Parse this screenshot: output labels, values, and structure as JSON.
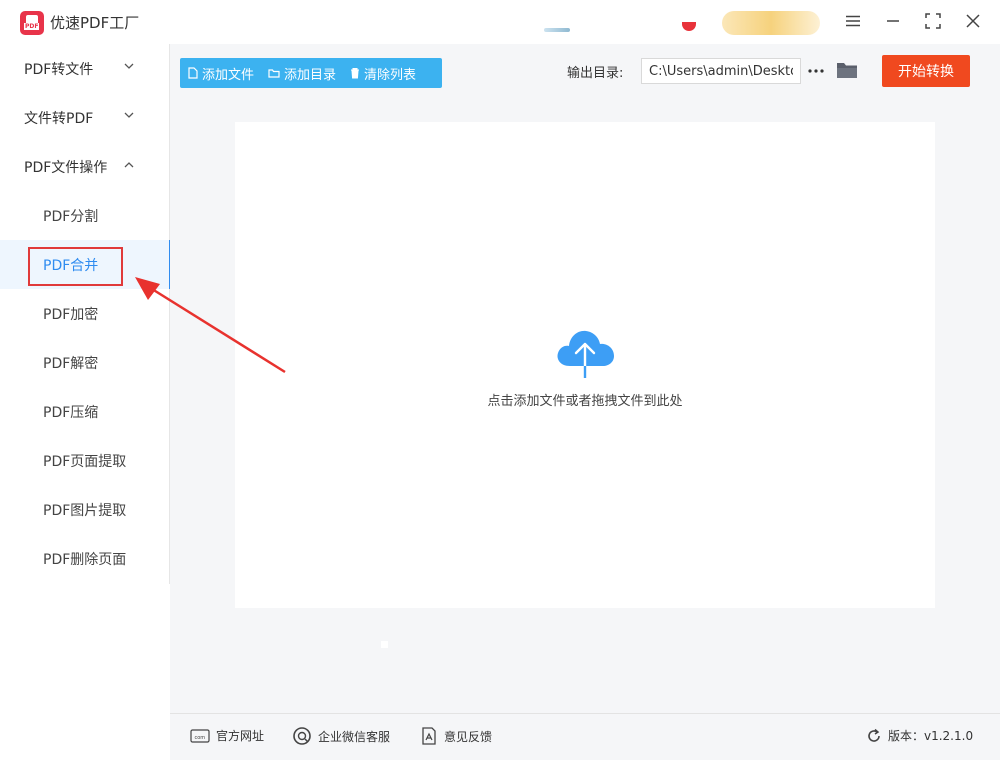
{
  "app": {
    "title": "优速PDF工厂"
  },
  "sidebar": {
    "groups": [
      {
        "label": "PDF转文件"
      },
      {
        "label": "文件转PDF"
      },
      {
        "label": "PDF文件操作"
      }
    ],
    "items": [
      {
        "label": "PDF分割"
      },
      {
        "label": "PDF合并"
      },
      {
        "label": "PDF加密"
      },
      {
        "label": "PDF解密"
      },
      {
        "label": "PDF压缩"
      },
      {
        "label": "PDF页面提取"
      },
      {
        "label": "PDF图片提取"
      },
      {
        "label": "PDF删除页面"
      }
    ]
  },
  "toolbar": {
    "add_file": "添加文件",
    "add_dir": "添加目录",
    "clear_list": "清除列表",
    "output_label": "输出目录:",
    "output_path": "C:\\Users\\admin\\Deskto",
    "start": "开始转换"
  },
  "drop": {
    "hint": "点击添加文件或者拖拽文件到此处"
  },
  "footer": {
    "website": "官方网址",
    "wechat": "企业微信客服",
    "feedback": "意见反馈",
    "version": "版本：v1.2.1.0"
  },
  "colors": {
    "accent": "#2f8cf0",
    "toolbar": "#3cb2f0",
    "start": "#f0491f",
    "highlight": "#e03a3a"
  }
}
